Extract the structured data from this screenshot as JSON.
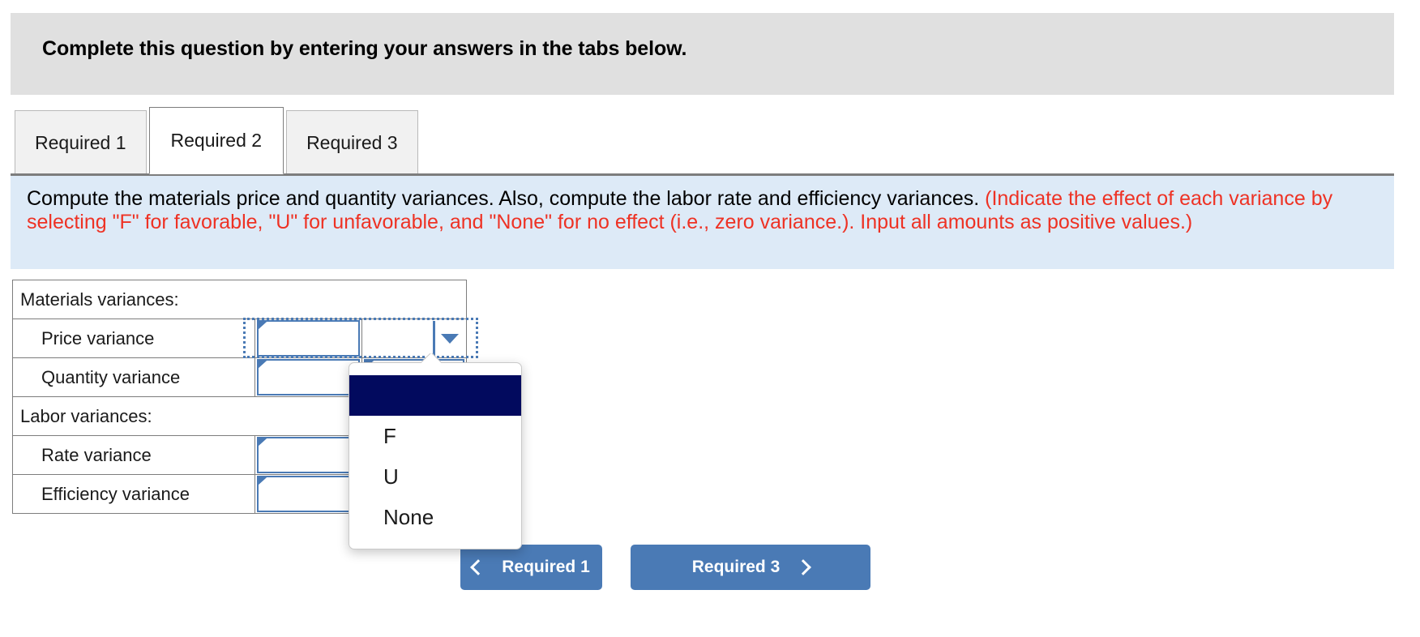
{
  "banner": {
    "title": "Complete this question by entering your answers in the tabs below."
  },
  "tabs": [
    {
      "label": "Required 1",
      "active": false
    },
    {
      "label": "Required 2",
      "active": true
    },
    {
      "label": "Required 3",
      "active": false
    }
  ],
  "instruction": {
    "black_text": "Compute the materials price and quantity variances. Also, compute the labor rate and efficiency variances. ",
    "red_text": "(Indicate the effect of each variance by selecting \"F\" for favorable, \"U\" for unfavorable, and \"None\" for no effect (i.e., zero variance.). Input all amounts as positive values.)",
    "red_color": "#ee3224",
    "background_color": "#ddeaf7"
  },
  "table": {
    "rows": [
      {
        "label": "Materials variances:",
        "type": "section",
        "amount": "",
        "effect": ""
      },
      {
        "label": "Price variance",
        "type": "entry",
        "amount": "",
        "effect": ""
      },
      {
        "label": "Quantity variance",
        "type": "entry",
        "amount": "",
        "effect": ""
      },
      {
        "label": "Labor variances:",
        "type": "section",
        "amount": "",
        "effect": ""
      },
      {
        "label": "Rate variance",
        "type": "entry",
        "amount": "",
        "effect": ""
      },
      {
        "label": "Efficiency variance",
        "type": "entry",
        "amount": "",
        "effect": ""
      }
    ]
  },
  "dropdown": {
    "open": true,
    "selected_index": 0,
    "options": [
      {
        "label": "",
        "selected": true
      },
      {
        "label": "F",
        "selected": false
      },
      {
        "label": "U",
        "selected": false
      },
      {
        "label": "None",
        "selected": false
      }
    ],
    "highlight_color": "#020a5e"
  },
  "footer": {
    "prev_label": "Required 1",
    "next_label": "Required 3",
    "button_color": "#4a7ab5"
  }
}
